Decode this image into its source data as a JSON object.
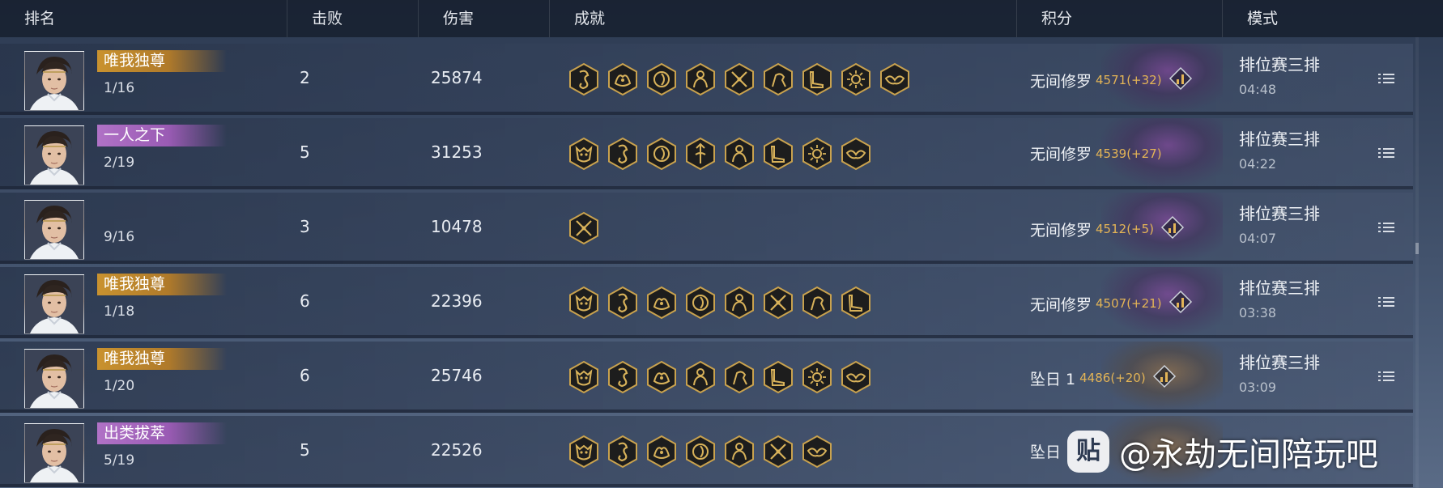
{
  "header": {
    "rank": "排名",
    "kills": "击败",
    "damage": "伤害",
    "achievements": "成就",
    "score": "积分",
    "mode": "模式"
  },
  "colors": {
    "gold_banner": "#c9922f",
    "purple_banner": "#b072c6",
    "score_text": "#e3b456",
    "badge_gold": "#d8b25a",
    "badge_bg": "#1d1d1d"
  },
  "rows": [
    {
      "title": "唯我独尊",
      "title_style": "gold",
      "rank": "1/16",
      "kills": "2",
      "damage": "25874",
      "achievements": [
        "dragon-icon",
        "tiger-icon",
        "swirl-icon",
        "warrior-icon",
        "crossed-swords-icon",
        "horse-icon",
        "boot-icon",
        "sun-icon",
        "wings-icon"
      ],
      "tier": "无间修罗",
      "score": "4571(+32)",
      "trend": "up",
      "mode": "排位赛三排",
      "time": "04:48"
    },
    {
      "title": "一人之下",
      "title_style": "purple",
      "rank": "2/19",
      "kills": "5",
      "damage": "31253",
      "achievements": [
        "demon-mask-icon",
        "dragon-icon",
        "swirl-icon",
        "spear-icon",
        "warrior-icon",
        "boot-icon",
        "sun-icon",
        "wings-icon"
      ],
      "tier": "无间修罗",
      "score": "4539(+27)",
      "trend": "none",
      "mode": "排位赛三排",
      "time": "04:22"
    },
    {
      "title": "",
      "title_style": "none",
      "rank": "9/16",
      "kills": "3",
      "damage": "10478",
      "achievements": [
        "crossed-swords-icon"
      ],
      "tier": "无间修罗",
      "score": "4512(+5)",
      "trend": "up",
      "mode": "排位赛三排",
      "time": "04:07"
    },
    {
      "title": "唯我独尊",
      "title_style": "gold",
      "rank": "1/18",
      "kills": "6",
      "damage": "22396",
      "achievements": [
        "demon-mask-icon",
        "dragon-icon",
        "tiger-icon",
        "swirl-icon",
        "warrior-icon",
        "crossed-swords-icon",
        "horse-icon",
        "boot-icon"
      ],
      "tier": "无间修罗",
      "score": "4507(+21)",
      "trend": "up",
      "mode": "排位赛三排",
      "time": "03:38"
    },
    {
      "title": "唯我独尊",
      "title_style": "gold",
      "rank": "1/20",
      "kills": "6",
      "damage": "25746",
      "achievements": [
        "demon-mask-icon",
        "dragon-icon",
        "tiger-icon",
        "warrior-icon",
        "horse-icon",
        "boot-icon",
        "sun-icon",
        "wings-icon"
      ],
      "tier": "坠日 1",
      "score": "4486(+20)",
      "trend": "up",
      "mode": "排位赛三排",
      "time": "03:09"
    },
    {
      "title": "出类拔萃",
      "title_style": "purple",
      "rank": "5/19",
      "kills": "5",
      "damage": "22526",
      "achievements": [
        "demon-mask-icon",
        "dragon-icon",
        "tiger-icon",
        "swirl-icon",
        "warrior-icon",
        "crossed-swords-icon",
        "wings-icon"
      ],
      "tier": "坠日",
      "score": "",
      "trend": "none",
      "mode": "",
      "time": ""
    }
  ],
  "watermark": {
    "logo": "贴",
    "text": "@永劫无间陪玩吧"
  }
}
